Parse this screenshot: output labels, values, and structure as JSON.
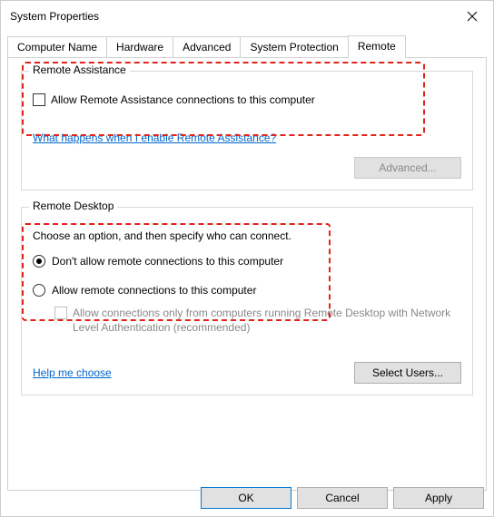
{
  "window": {
    "title": "System Properties"
  },
  "tabs": {
    "computer_name": "Computer Name",
    "hardware": "Hardware",
    "advanced": "Advanced",
    "system_protection": "System Protection",
    "remote": "Remote"
  },
  "remote_assistance": {
    "title": "Remote Assistance",
    "allow_label": "Allow Remote Assistance connections to this computer",
    "link_text": "What happens when I enable Remote Assistance?",
    "advanced_btn": "Advanced..."
  },
  "remote_desktop": {
    "title": "Remote Desktop",
    "description": "Choose an option, and then specify who can connect.",
    "opt_disallow": "Don't allow remote connections to this computer",
    "opt_allow": "Allow remote connections to this computer",
    "nla_label": "Allow connections only from computers running Remote Desktop with Network Level Authentication (recommended)",
    "help_link": "Help me choose",
    "select_users_btn": "Select Users..."
  },
  "buttons": {
    "ok": "OK",
    "cancel": "Cancel",
    "apply": "Apply"
  }
}
